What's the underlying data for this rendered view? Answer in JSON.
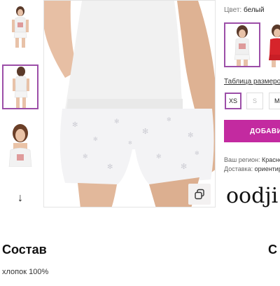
{
  "thumbnails": {
    "items": [
      {
        "name": "thumbnail-front-full"
      },
      {
        "name": "thumbnail-back-shorts",
        "selected": true
      },
      {
        "name": "thumbnail-top-closeup"
      }
    ],
    "next_icon": "arrow-down-icon"
  },
  "product": {
    "color_label": "Цвет:",
    "color_value": "белый",
    "size_table_link": "Таблица размеров",
    "sizes": [
      {
        "label": "XS",
        "selected": true,
        "available": true
      },
      {
        "label": "S",
        "selected": false,
        "available": false
      },
      {
        "label": "M",
        "selected": false,
        "available": true
      }
    ],
    "add_button": "ДОБАВИ",
    "region_label": "Ваш регион:",
    "region_value": "Красно",
    "delivery_label": "Доставка:",
    "delivery_value": "ориентир",
    "brand": "oodji"
  },
  "composition": {
    "title": "Состав",
    "value": "хлопок 100%"
  },
  "care": {
    "title": "С"
  },
  "colors": {
    "accent": "#9c4fa8",
    "button": "#c32aa0"
  }
}
